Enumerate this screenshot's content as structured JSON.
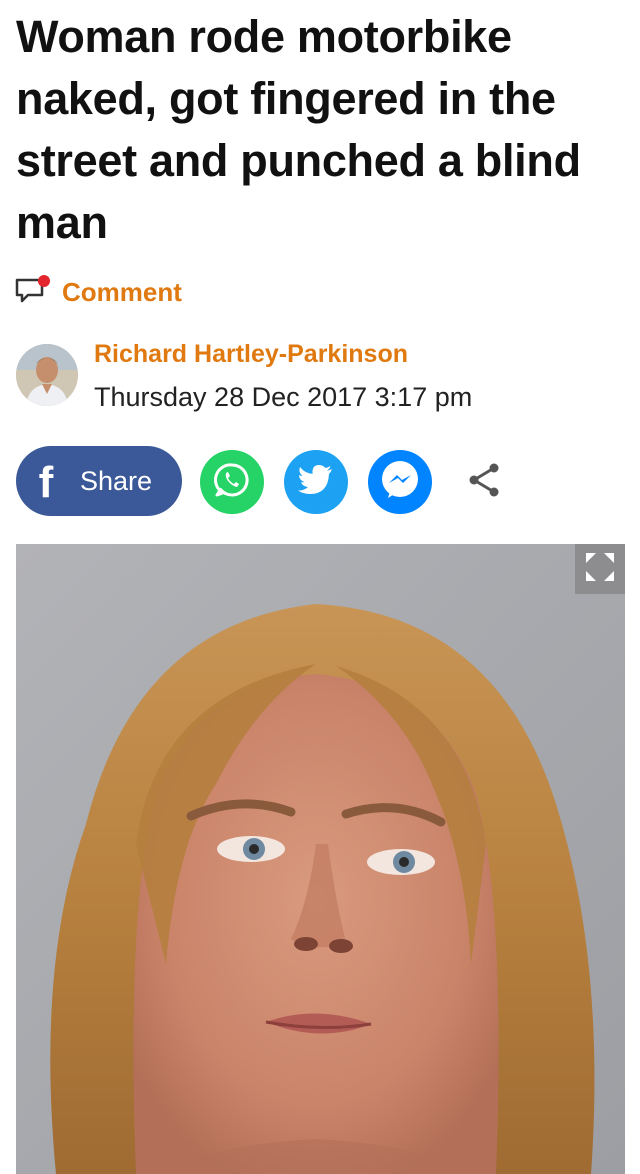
{
  "article": {
    "headline": "Woman rode motorbike naked, got fingered in the street and punched a blind man",
    "comment_label": "Comment",
    "author_name": "Richard Hartley-Parkinson",
    "published": "Thursday 28 Dec 2017 3:17 pm"
  },
  "share": {
    "facebook_glyph": "f",
    "facebook_label": "Share",
    "buttons": [
      "whatsapp-icon",
      "twitter-icon",
      "messenger-icon",
      "share-icon"
    ]
  },
  "colors": {
    "accent": "#e0790f",
    "facebook": "#3b5998",
    "whatsapp": "#25d366",
    "twitter": "#1da1f2",
    "messenger": "#0084ff",
    "headline": "#111111"
  },
  "media": {
    "image": "mugshot-photo",
    "expand_icon": "expand-icon"
  }
}
